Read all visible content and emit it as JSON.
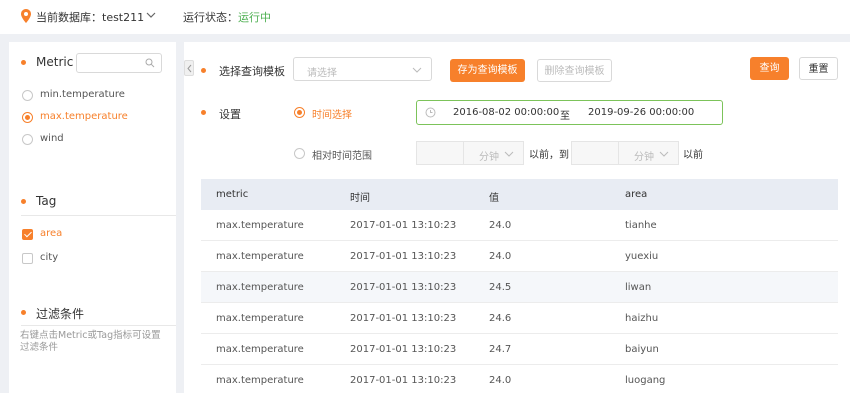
{
  "header": {
    "db_label": "当前数据库：test211",
    "run_label": "运行状态：",
    "run_status": "运行中",
    "colors": {
      "accent": "#f7802b",
      "status_ok": "#4caf50"
    }
  },
  "sidebar": {
    "metric_title": "Metric",
    "metric_search_icon": "search-icon",
    "metrics": [
      {
        "label": "min.temperature",
        "selected": false
      },
      {
        "label": "max.temperature",
        "selected": true
      },
      {
        "label": "wind",
        "selected": false
      }
    ],
    "tag_title": "Tag",
    "tags": [
      {
        "label": "area",
        "checked": true
      },
      {
        "label": "city",
        "checked": false
      }
    ],
    "filter_title": "过滤条件",
    "filter_hint": "右键点击Metric或Tag指标可设置过滤条件"
  },
  "query": {
    "template_label": "选择查询模板",
    "template_placeholder": "请选择",
    "save_template": "存为查询模板",
    "delete_template": "删除查询模板",
    "query_button": "查询",
    "reset_button": "重置",
    "settings_label": "设置",
    "time_select_label": "时间选择",
    "time_start": "2016-08-02 00:00:00",
    "time_to": "至",
    "time_end": "2019-09-26 00:00:00",
    "relative_label": "相对时间范围",
    "unit_1": "分钟",
    "before_to": "以前，到",
    "unit_2": "分钟",
    "before": "以前"
  },
  "table": {
    "columns": [
      "metric",
      "时间",
      "值",
      "area"
    ],
    "rows": [
      [
        "max.temperature",
        "2017-01-01 13:10:23",
        "24.0",
        "tianhe"
      ],
      [
        "max.temperature",
        "2017-01-01 13:10:23",
        "24.0",
        "yuexiu"
      ],
      [
        "max.temperature",
        "2017-01-01 13:10:23",
        "24.5",
        "liwan"
      ],
      [
        "max.temperature",
        "2017-01-01 13:10:23",
        "24.6",
        "haizhu"
      ],
      [
        "max.temperature",
        "2017-01-01 13:10:23",
        "24.7",
        "baiyun"
      ],
      [
        "max.temperature",
        "2017-01-01 13:10:23",
        "24.0",
        "luogang"
      ]
    ]
  }
}
